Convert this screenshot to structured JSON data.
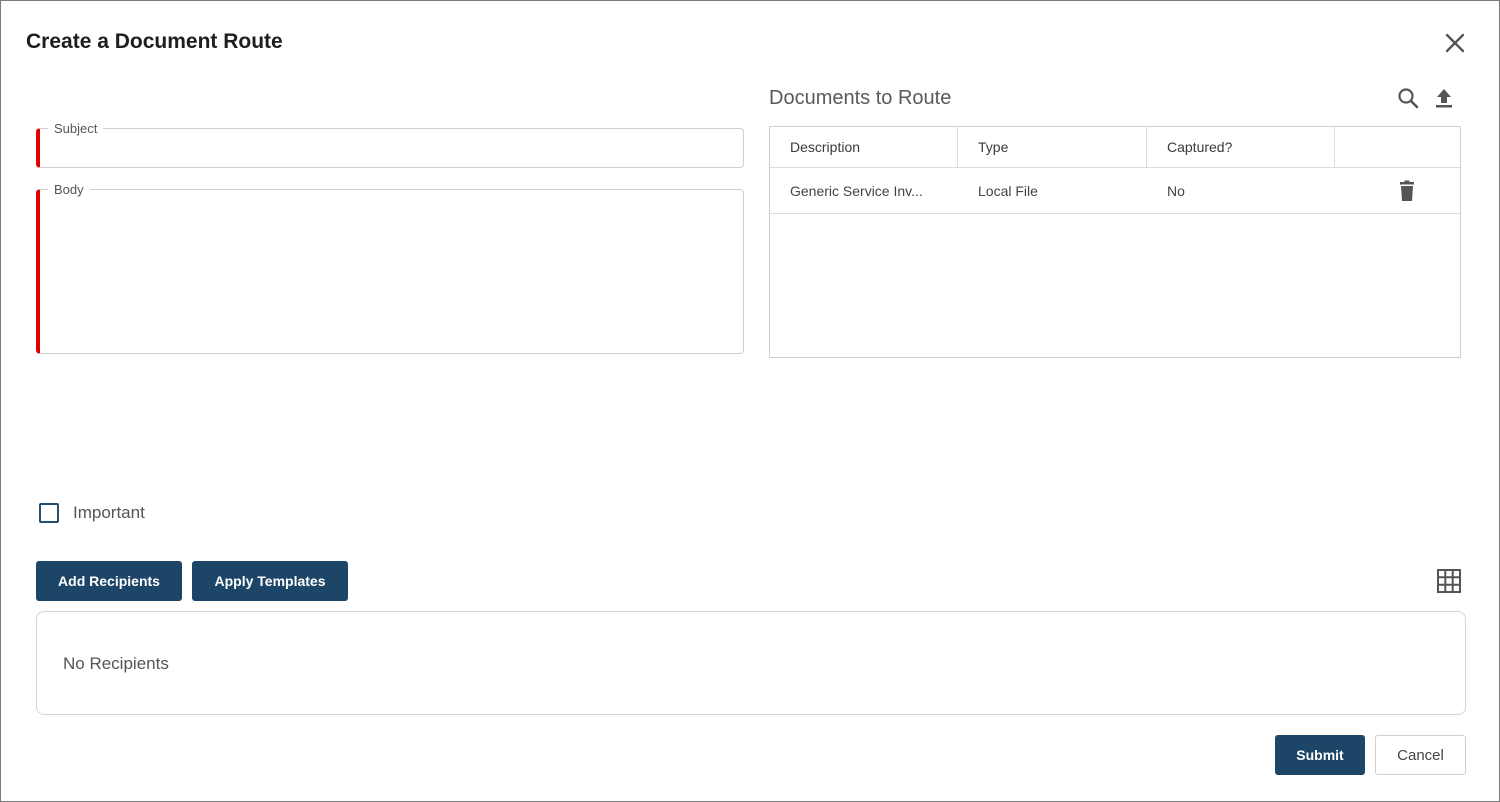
{
  "dialog": {
    "title": "Create a Document Route"
  },
  "form": {
    "subject_label": "Subject",
    "subject_value": "",
    "body_label": "Body",
    "body_value": ""
  },
  "documents": {
    "title": "Documents to Route",
    "columns": [
      "Description",
      "Type",
      "Captured?"
    ],
    "rows": [
      {
        "description": "Generic Service Inv...",
        "type": "Local File",
        "captured": "No"
      }
    ]
  },
  "important": {
    "label": "Important",
    "checked": false
  },
  "recipients": {
    "add_label": "Add Recipients",
    "templates_label": "Apply Templates",
    "empty_text": "No Recipients"
  },
  "footer": {
    "submit_label": "Submit",
    "cancel_label": "Cancel"
  },
  "colors": {
    "primary": "#1d4567",
    "required_marker": "#e00000"
  },
  "icons": [
    "close-icon",
    "search-icon",
    "upload-icon",
    "trash-icon",
    "grid-icon"
  ]
}
